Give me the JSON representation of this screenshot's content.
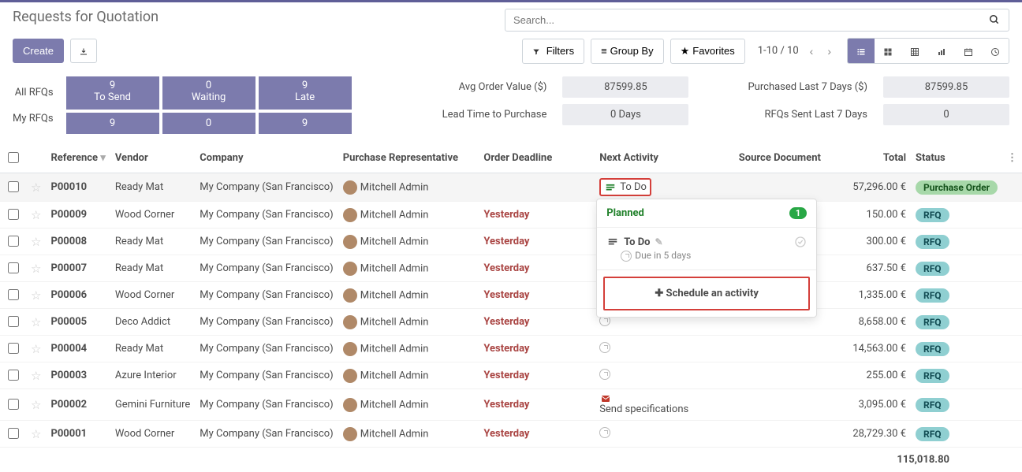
{
  "header": {
    "title": "Requests for Quotation",
    "search_placeholder": "Search...",
    "create_label": "Create",
    "filters_label": "Filters",
    "groupby_label": "Group By",
    "favorites_label": "Favorites",
    "pager_text": "1-10 / 10"
  },
  "dashboard": {
    "row_labels": {
      "all": "All RFQs",
      "my": "My RFQs"
    },
    "cols": {
      "tosend": "To Send",
      "waiting": "Waiting",
      "late": "Late"
    },
    "all": {
      "tosend": "9",
      "waiting": "0",
      "late": "9"
    },
    "my": {
      "tosend": "9",
      "waiting": "0",
      "late": "9"
    },
    "stats": {
      "avg_label": "Avg Order Value ($)",
      "avg_val": "87599.85",
      "lead_label": "Lead Time to Purchase",
      "lead_val": "0  Days",
      "purchased_label": "Purchased Last 7 Days ($)",
      "purchased_val": "87599.85",
      "rfqs_sent_label": "RFQs Sent Last 7 Days",
      "rfqs_sent_val": "0"
    }
  },
  "columns": {
    "reference": "Reference",
    "vendor": "Vendor",
    "company": "Company",
    "rep": "Purchase Representative",
    "deadline": "Order Deadline",
    "activity": "Next Activity",
    "source": "Source Document",
    "total": "Total",
    "status": "Status"
  },
  "rows": [
    {
      "ref": "P00010",
      "vendor": "Ready Mat",
      "company": "My Company (San Francisco)",
      "rep": "Mitchell Admin",
      "deadline": "",
      "deadline_red": false,
      "activity": "To Do",
      "activity_icon": "task",
      "total": "57,296.00 €",
      "status": "Purchase Order",
      "status_color": "green",
      "highlight": true
    },
    {
      "ref": "P00009",
      "vendor": "Wood Corner",
      "company": "My Company (San Francisco)",
      "rep": "Mitchell Admin",
      "deadline": "Yesterday",
      "deadline_red": true,
      "activity": "",
      "activity_icon": "clock",
      "total": "150.00 €",
      "status": "RFQ",
      "status_color": "blue"
    },
    {
      "ref": "P00008",
      "vendor": "Ready Mat",
      "company": "My Company (San Francisco)",
      "rep": "Mitchell Admin",
      "deadline": "Yesterday",
      "deadline_red": true,
      "activity": "",
      "activity_icon": "clock",
      "total": "300.00 €",
      "status": "RFQ",
      "status_color": "blue"
    },
    {
      "ref": "P00007",
      "vendor": "Ready Mat",
      "company": "My Company (San Francisco)",
      "rep": "Mitchell Admin",
      "deadline": "Yesterday",
      "deadline_red": true,
      "activity": "",
      "activity_icon": "clock",
      "total": "637.50 €",
      "status": "RFQ",
      "status_color": "blue"
    },
    {
      "ref": "P00006",
      "vendor": "Wood Corner",
      "company": "My Company (San Francisco)",
      "rep": "Mitchell Admin",
      "deadline": "Yesterday",
      "deadline_red": true,
      "activity": "",
      "activity_icon": "clock",
      "total": "1,335.00 €",
      "status": "RFQ",
      "status_color": "blue"
    },
    {
      "ref": "P00005",
      "vendor": "Deco Addict",
      "company": "My Company (San Francisco)",
      "rep": "Mitchell Admin",
      "deadline": "Yesterday",
      "deadline_red": true,
      "activity": "",
      "activity_icon": "clock",
      "total": "8,658.00 €",
      "status": "RFQ",
      "status_color": "blue"
    },
    {
      "ref": "P00004",
      "vendor": "Ready Mat",
      "company": "My Company (San Francisco)",
      "rep": "Mitchell Admin",
      "deadline": "Yesterday",
      "deadline_red": true,
      "activity": "",
      "activity_icon": "clock",
      "total": "14,563.00 €",
      "status": "RFQ",
      "status_color": "blue"
    },
    {
      "ref": "P00003",
      "vendor": "Azure Interior",
      "company": "My Company (San Francisco)",
      "rep": "Mitchell Admin",
      "deadline": "Yesterday",
      "deadline_red": true,
      "activity": "",
      "activity_icon": "clock",
      "total": "255.00 €",
      "status": "RFQ",
      "status_color": "blue"
    },
    {
      "ref": "P00002",
      "vendor": "Gemini Furniture",
      "company": "My Company (San Francisco)",
      "rep": "Mitchell Admin",
      "deadline": "Yesterday",
      "deadline_red": true,
      "activity": "Send specifications",
      "activity_icon": "envelope",
      "total": "3,095.00 €",
      "status": "RFQ",
      "status_color": "blue"
    },
    {
      "ref": "P00001",
      "vendor": "Wood Corner",
      "company": "My Company (San Francisco)",
      "rep": "Mitchell Admin",
      "deadline": "Yesterday",
      "deadline_red": true,
      "activity": "",
      "activity_icon": "clock",
      "total": "28,729.30 €",
      "status": "RFQ",
      "status_color": "blue"
    }
  ],
  "popover": {
    "planned": "Planned",
    "count": "1",
    "title": "To Do",
    "due": "Due in 5 days",
    "schedule": "Schedule an activity"
  },
  "footer_total": "115,018.80"
}
